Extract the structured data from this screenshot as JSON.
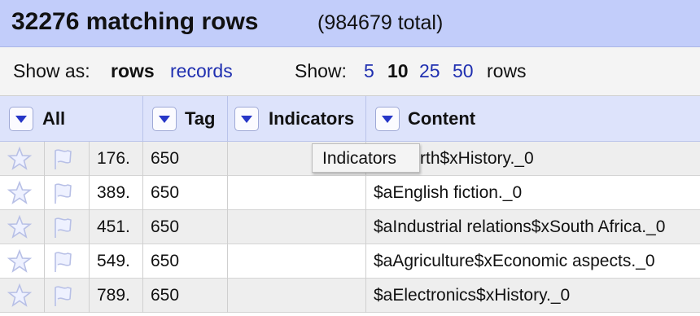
{
  "header": {
    "matching": "32276 matching rows",
    "total": "(984679 total)"
  },
  "controls": {
    "show_as_label": "Show as:",
    "rows_mode": "rows",
    "records_mode": "records",
    "show_label": "Show:",
    "page_sizes": [
      "5",
      "10",
      "25",
      "50"
    ],
    "selected_page_size": "10",
    "rows_suffix": "rows"
  },
  "columns": {
    "all": "All",
    "tag": "Tag",
    "indicators": "Indicators",
    "content": "Content"
  },
  "tooltip": "Indicators",
  "rows": [
    {
      "num": "176.",
      "tag": "650",
      "indicators": "",
      "content": "rth$xHistory._0"
    },
    {
      "num": "389.",
      "tag": "650",
      "indicators": "",
      "content": "$aEnglish fiction._0"
    },
    {
      "num": "451.",
      "tag": "650",
      "indicators": "",
      "content": "$aIndustrial relations$xSouth Africa._0"
    },
    {
      "num": "549.",
      "tag": "650",
      "indicators": "",
      "content": "$aAgriculture$xEconomic aspects._0"
    },
    {
      "num": "789.",
      "tag": "650",
      "indicators": "",
      "content": "$aElectronics$xHistory._0"
    }
  ],
  "icons": {
    "star": "star-icon",
    "flag": "flag-icon",
    "dropdown": "dropdown-arrow-icon"
  },
  "colors": {
    "header_bg": "#c2cdfa",
    "column_header_bg": "#dde3fb",
    "link": "#1f2fb0",
    "dropdown_arrow": "#2636c7"
  }
}
